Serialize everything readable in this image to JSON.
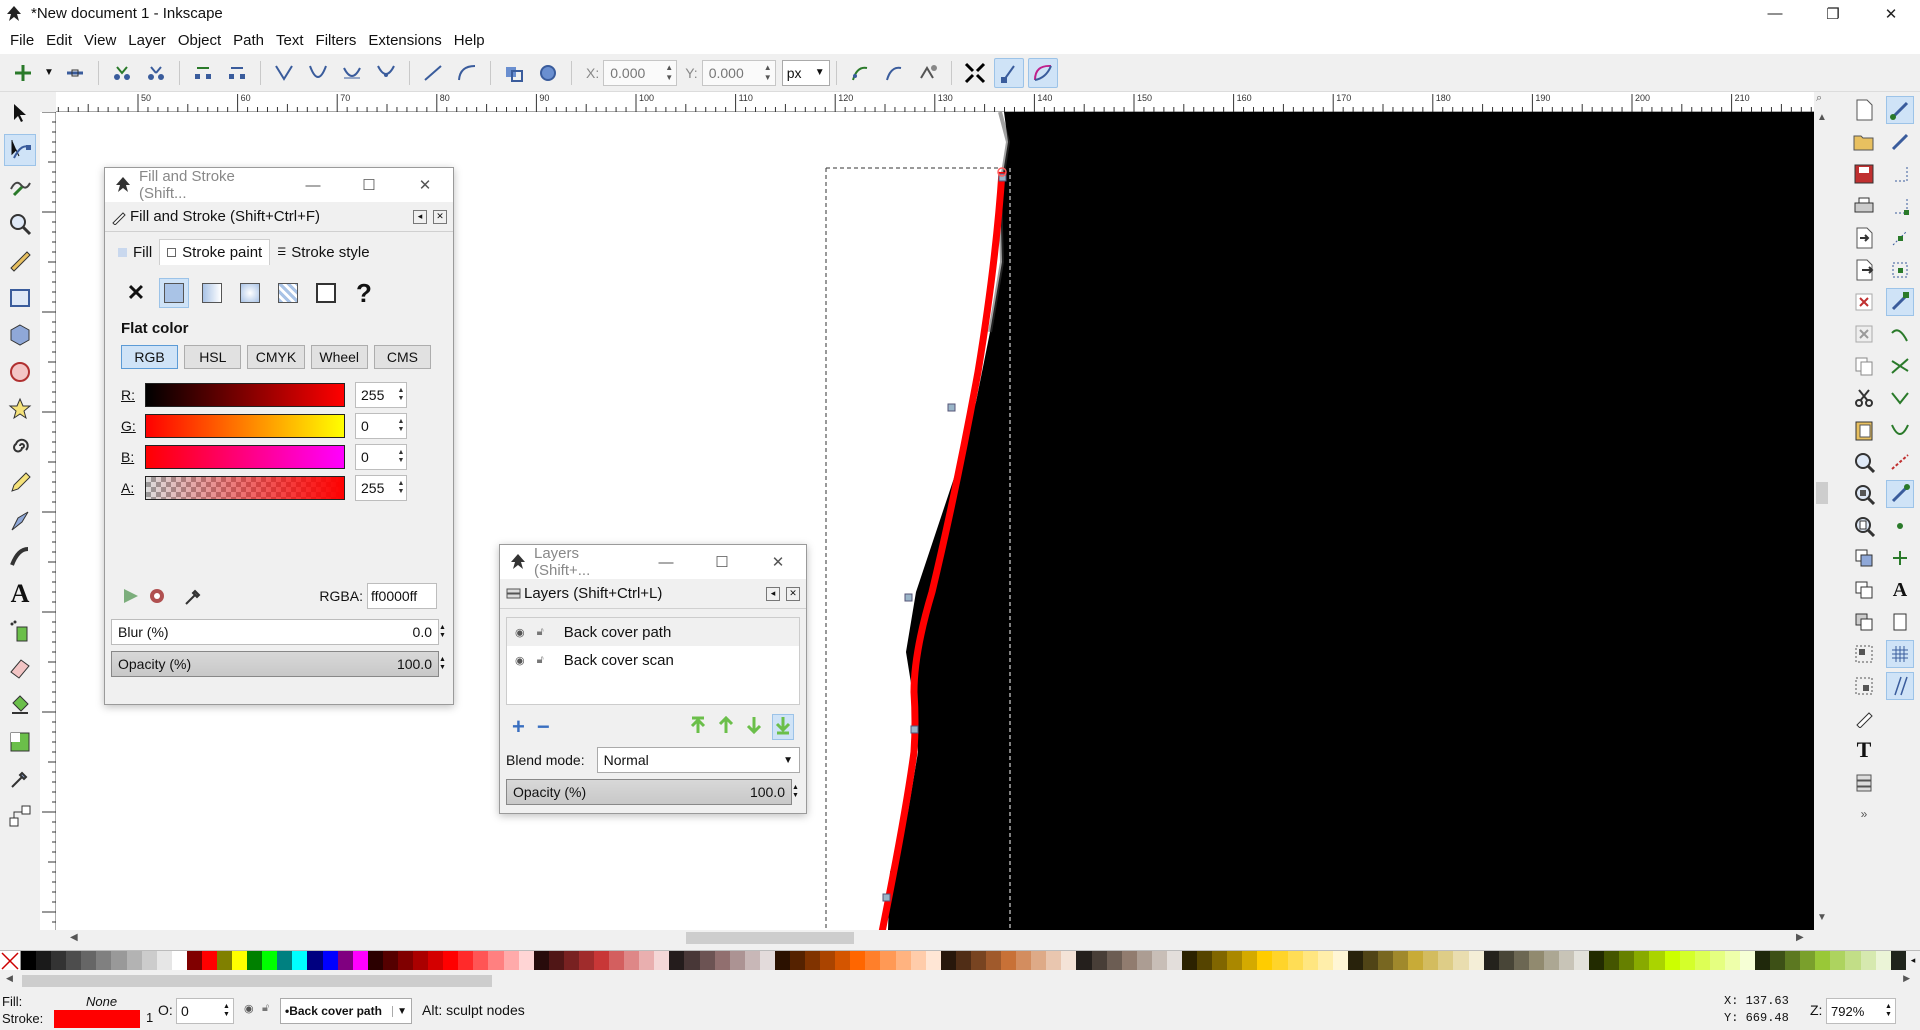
{
  "window": {
    "title": "*New document 1 - Inkscape",
    "min": "—",
    "restore": "❐",
    "close": "✕"
  },
  "menu": [
    "File",
    "Edit",
    "View",
    "Layer",
    "Object",
    "Path",
    "Text",
    "Filters",
    "Extensions",
    "Help"
  ],
  "controls": {
    "x_label": "X:",
    "x_value": "0.000",
    "y_label": "Y:",
    "y_value": "0.000",
    "unit": "px"
  },
  "ruler_labels": [
    "50",
    "60",
    "70",
    "80",
    "90",
    "100",
    "110",
    "120",
    "130",
    "140",
    "150",
    "160",
    "170",
    "180",
    "190",
    "200",
    "210"
  ],
  "fill_stroke": {
    "window_title": "Fill and Stroke (Shift...",
    "header": "Fill and Stroke (Shift+Ctrl+F)",
    "tabs": [
      "Fill",
      "Stroke paint",
      "Stroke style"
    ],
    "paint_type": "Flat color",
    "modes": [
      "RGB",
      "HSL",
      "CMYK",
      "Wheel",
      "CMS"
    ],
    "channels": [
      {
        "label": "R:",
        "value": "255"
      },
      {
        "label": "G:",
        "value": "0"
      },
      {
        "label": "B:",
        "value": "0"
      },
      {
        "label": "A:",
        "value": "255"
      }
    ],
    "rgba_label": "RGBA:",
    "rgba_value": "ff0000ff",
    "blur_label": "Blur (%)",
    "blur_value": "0.0",
    "opacity_label": "Opacity (%)",
    "opacity_value": "100.0"
  },
  "layers": {
    "window_title": "Layers (Shift+...",
    "header": "Layers (Shift+Ctrl+L)",
    "items": [
      "Back cover path",
      "Back cover scan"
    ],
    "blend_label": "Blend mode:",
    "blend_value": "Normal",
    "opacity_label": "Opacity (%)",
    "opacity_value": "100.0"
  },
  "status": {
    "fill_label": "Fill:",
    "fill_value": "None",
    "stroke_label": "Stroke:",
    "stroke_width": "1",
    "o_label": "O:",
    "o_value": "0",
    "layer_name": "•Back cover path",
    "message": "Alt: sculpt nodes",
    "x_readout": "X: 137.63",
    "y_readout": "Y: 669.48",
    "zoom_label": "Z:",
    "zoom_value": "792%"
  },
  "colors": {
    "stroke_red": "#ff0000",
    "scan_black": "#000000",
    "accent_blue": "#cfe3f7"
  },
  "palette": [
    "#000000",
    "#1a1a1a",
    "#333333",
    "#4d4d4d",
    "#666666",
    "#808080",
    "#999999",
    "#b3b3b3",
    "#cccccc",
    "#e6e6e6",
    "#ffffff",
    "#800000",
    "#ff0000",
    "#808000",
    "#ffff00",
    "#008000",
    "#00ff00",
    "#008080",
    "#00ffff",
    "#000080",
    "#0000ff",
    "#800080",
    "#ff00ff",
    "#2b0000",
    "#550000",
    "#800000",
    "#aa0000",
    "#d40000",
    "#ff0000",
    "#ff2a2a",
    "#ff5555",
    "#ff8080",
    "#ffaaaa",
    "#ffd5d5",
    "#280b0b",
    "#501616",
    "#782121",
    "#a02c2c",
    "#c83737",
    "#d35f5f",
    "#de8787",
    "#e9afaf",
    "#f4d7d7",
    "#241c1c",
    "#483737",
    "#6c5353",
    "#916f6f",
    "#ac9393",
    "#c8b7b7",
    "#e3dbdb",
    "#2b1100",
    "#552200",
    "#803300",
    "#aa4400",
    "#d45500",
    "#ff6600",
    "#ff7f2a",
    "#ff9955",
    "#ffb380",
    "#ffccaa",
    "#ffe6d5",
    "#28170b",
    "#502d16",
    "#784421",
    "#a05a2c",
    "#c87137",
    "#d38d5f",
    "#deaa87",
    "#e9c6af",
    "#f4e3d7",
    "#241f1c",
    "#483e37",
    "#6c5d53",
    "#917c6f",
    "#ac9d93",
    "#c8beb7",
    "#e3dedb",
    "#2b2200",
    "#554400",
    "#806600",
    "#aa8800",
    "#d4aa00",
    "#ffcc00",
    "#ffd42a",
    "#ffdd55",
    "#ffe680",
    "#ffeeaa",
    "#fff6d5",
    "#28220b",
    "#504416",
    "#786721",
    "#a0892c",
    "#c8ab37",
    "#d3bc5f",
    "#decd87",
    "#e9ddaf",
    "#f4eed7",
    "#24221c",
    "#484537",
    "#6c6753",
    "#918a6f",
    "#aca793",
    "#c8c4b7",
    "#e3e2db",
    "#222b00",
    "#445500",
    "#668000",
    "#88aa00",
    "#aad400",
    "#ccff00",
    "#d4ff2a",
    "#ddff55",
    "#e5ff80",
    "#eeffaa",
    "#f6ffd5",
    "#1f280b",
    "#3d5016",
    "#5c7821",
    "#7aa02c",
    "#99c837",
    "#add35f",
    "#c2de87",
    "#d6e9af",
    "#ebf4d7",
    "#1f241c"
  ]
}
